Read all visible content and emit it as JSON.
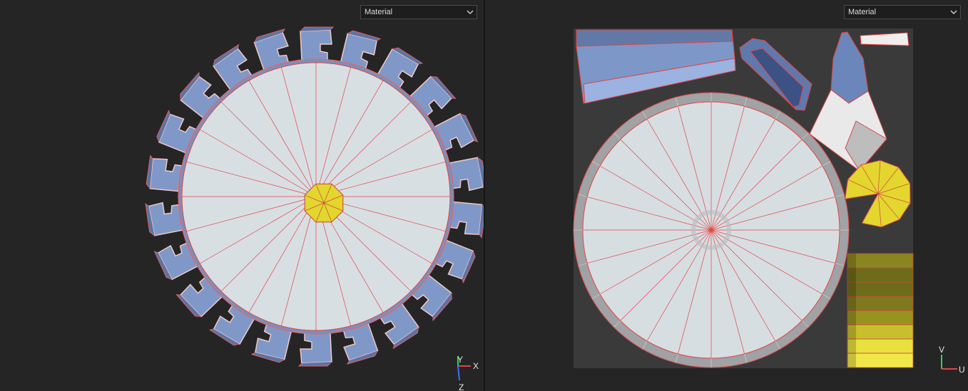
{
  "viewport_3d": {
    "shading_mode": "Material",
    "axes": {
      "y": "Y",
      "x": "X",
      "z": "Z"
    }
  },
  "viewport_uv": {
    "shading_mode": "Material",
    "axes": {
      "v": "V",
      "u": "U"
    }
  },
  "colors": {
    "background": "#252525",
    "surface": "#d6dde2",
    "wire": "#ff3b3b",
    "blue_part": "#7f98c8",
    "yellow_part": "#e2d838",
    "uv_canvas": "#3a3a3a"
  }
}
